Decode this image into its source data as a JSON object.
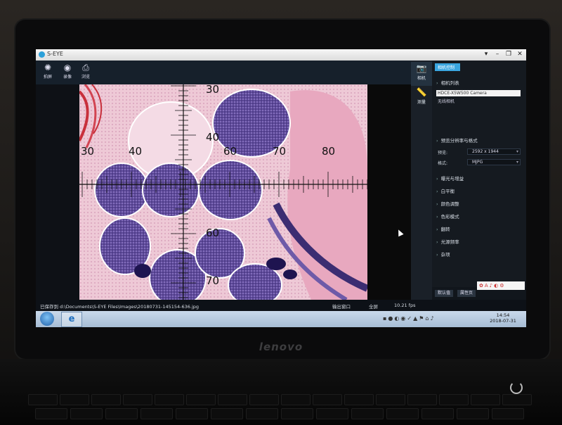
{
  "window": {
    "title": "S-EYE",
    "buttons": [
      "▾",
      "–",
      "❐",
      "✕"
    ]
  },
  "toolbar": {
    "items": [
      {
        "label": "拍屏",
        "icon": "shutter-icon"
      },
      {
        "label": "录像",
        "icon": "record-icon"
      },
      {
        "label": "浏览",
        "icon": "browse-icon"
      }
    ]
  },
  "right_panel": {
    "tabs": [
      {
        "label": "相机",
        "icon": "camera-icon"
      },
      {
        "label": "测量",
        "icon": "ruler-icon"
      }
    ],
    "tag": "相机控制",
    "camera_list_title": "相机列表",
    "camera_name": "HDCE-X5W500 Camera",
    "no_camera": "无线相机",
    "resolution_section": "预览分辨率与格式",
    "preview_label": "预览:",
    "preview_value": "2592 x 1944",
    "format_label": "格式:",
    "format_value": "MJPG",
    "sections": [
      "曝光与增益",
      "白平衡",
      "颜色调整",
      "色彩模式",
      "翻转",
      "光源频率",
      "杂项"
    ],
    "default_button": "默认值",
    "properties_button": "属性页"
  },
  "status": {
    "saved_path": "已保存到 d:\\Documents\\S-EYE Files\\Images\\20180731-145154-636.jpg",
    "output_window": "输出窗口",
    "fullscreen": "全屏",
    "fps": "10.21 fps"
  },
  "taskbar": {
    "time": "14:54",
    "date": "2018-07-31"
  },
  "reticle": {
    "h_labels": [
      "30",
      "40",
      "60",
      "70",
      "80"
    ],
    "v_labels": [
      "30",
      "40",
      "60",
      "70"
    ]
  },
  "laptop": {
    "brand": "lenovo"
  }
}
